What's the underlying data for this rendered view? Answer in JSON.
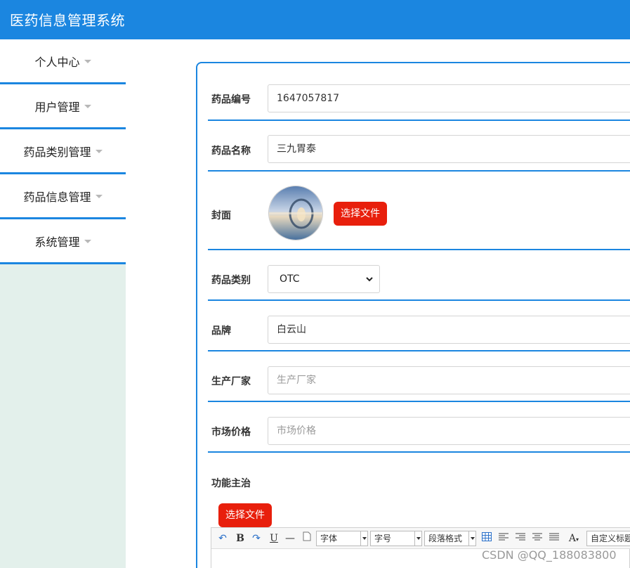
{
  "app": {
    "title": "医药信息管理系统"
  },
  "sidebar": {
    "items": [
      {
        "label": "个人中心"
      },
      {
        "label": "用户管理"
      },
      {
        "label": "药品类别管理"
      },
      {
        "label": "药品信息管理"
      },
      {
        "label": "系统管理"
      }
    ]
  },
  "form": {
    "code": {
      "label": "药品编号",
      "value": "1647057817"
    },
    "name": {
      "label": "药品名称",
      "value": "三九胃泰"
    },
    "cover": {
      "label": "封面",
      "button": "选择文件"
    },
    "category": {
      "label": "药品类别",
      "selected": "OTC"
    },
    "brand": {
      "label": "品牌",
      "value": "白云山"
    },
    "manufacturer": {
      "label": "生产厂家",
      "placeholder": "生产厂家"
    },
    "price": {
      "label": "市场价格",
      "placeholder": "市场价格"
    },
    "indications": {
      "label": "功能主治",
      "button": "选择文件"
    }
  },
  "editor": {
    "font_family": "字体",
    "font_size": "字号",
    "paragraph": "段落格式",
    "custom_title": "自定义标题"
  },
  "watermark": "CSDN @QQ_188083800",
  "colors": {
    "primary": "#1b86e0",
    "danger": "#e81f0c",
    "sidebar_bg": "#e3f0eb"
  }
}
